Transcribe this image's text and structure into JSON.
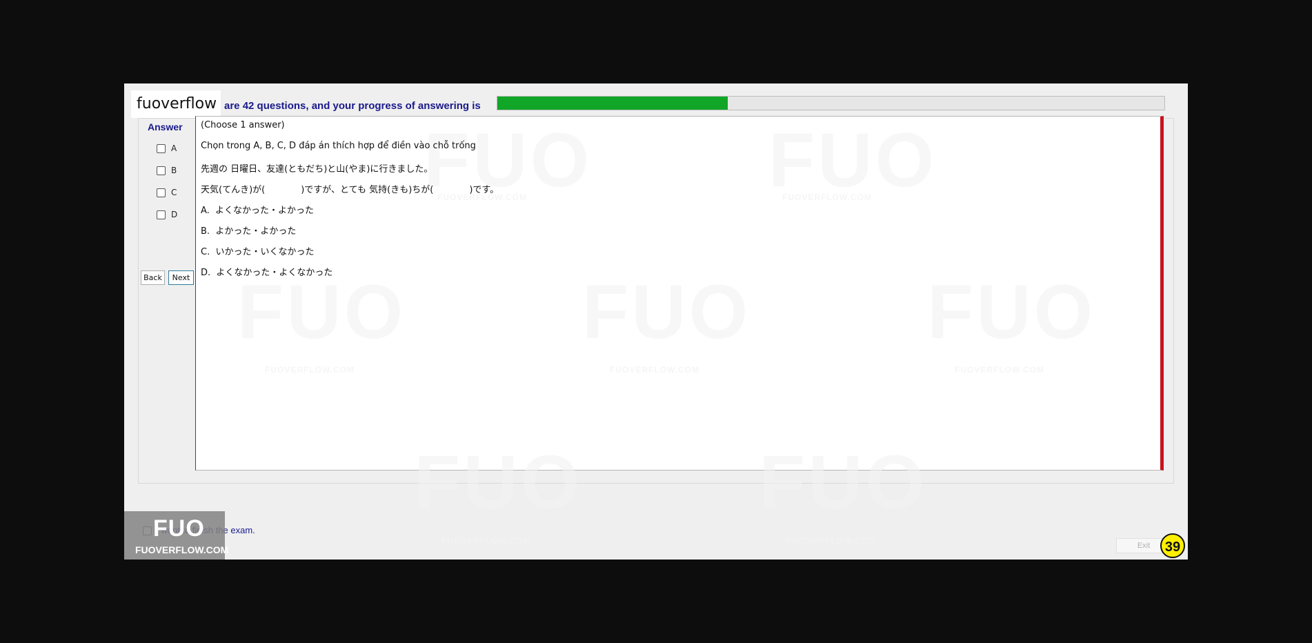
{
  "header": {
    "logo_text": "fuoverflow",
    "progress_text": "are 42 questions, and your progress of answering is",
    "progress_fraction": 0.345,
    "progress_color": "#11a627"
  },
  "answer": {
    "title": "Answer",
    "options": [
      "A",
      "B",
      "C",
      "D"
    ],
    "back_label": "Back",
    "next_label": "Next"
  },
  "question": {
    "lines": [
      "(Choose 1 answer)",
      "Chọn trong A, B, C, D đáp án thích hợp để điền vào chỗ trống",
      "先週の 日曜日、友達(ともだち)と山(やま)に行きました。",
      "天気(てんき)が(　　　　)ですが、とても 気持(きも)ちが(　　　　)です。",
      "A.  よくなかった・よかった",
      "B.  よかった・よかった",
      "C.  いかった・いくなかった",
      "D.  よくなかった・よくなかった"
    ],
    "accent_color": "#c8141c"
  },
  "watermark": {
    "big": "FUO",
    "small": "FUOVERFLOW.COM"
  },
  "footer": {
    "finish_label": "I want to finish the exam.",
    "badge_fuo": "FUO",
    "badge_site": "FUOVERFLOW.COM",
    "exit_label": "Exit",
    "timer_value": "39"
  }
}
